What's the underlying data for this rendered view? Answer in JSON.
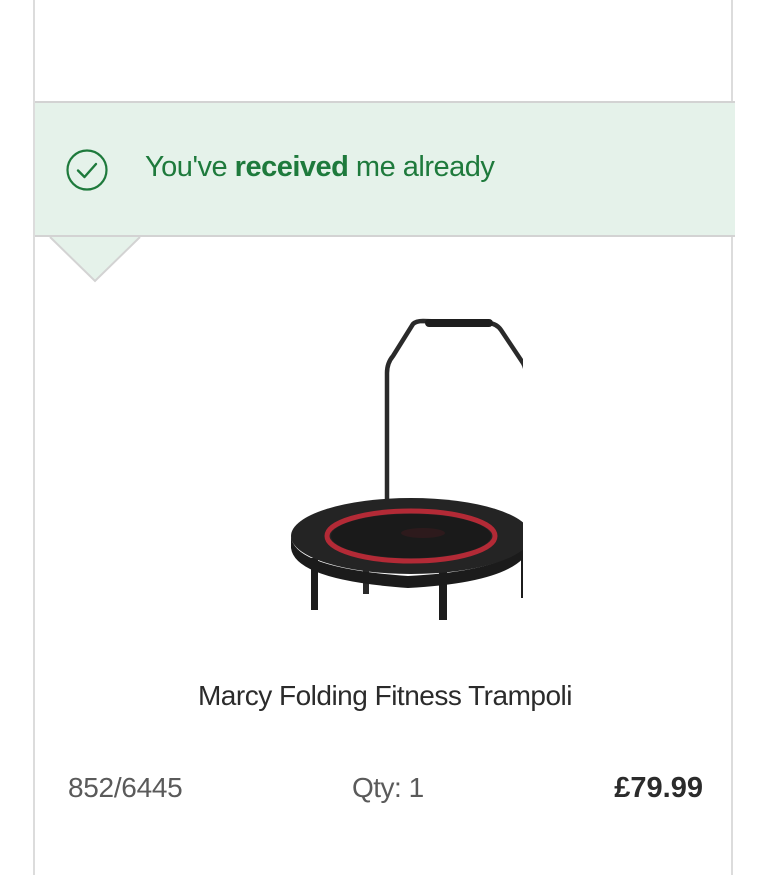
{
  "status": {
    "prefix": "You've ",
    "emphasis": "received",
    "suffix": " me already",
    "icon": "check-circle-icon",
    "color": "#1e7a3c",
    "background": "#e5f2ea"
  },
  "product": {
    "name": "Marcy Folding Fitness Trampoli",
    "sku": "852/6445",
    "quantity": "Qty: 1",
    "price": "£79.99",
    "image": "trampoline-image"
  }
}
